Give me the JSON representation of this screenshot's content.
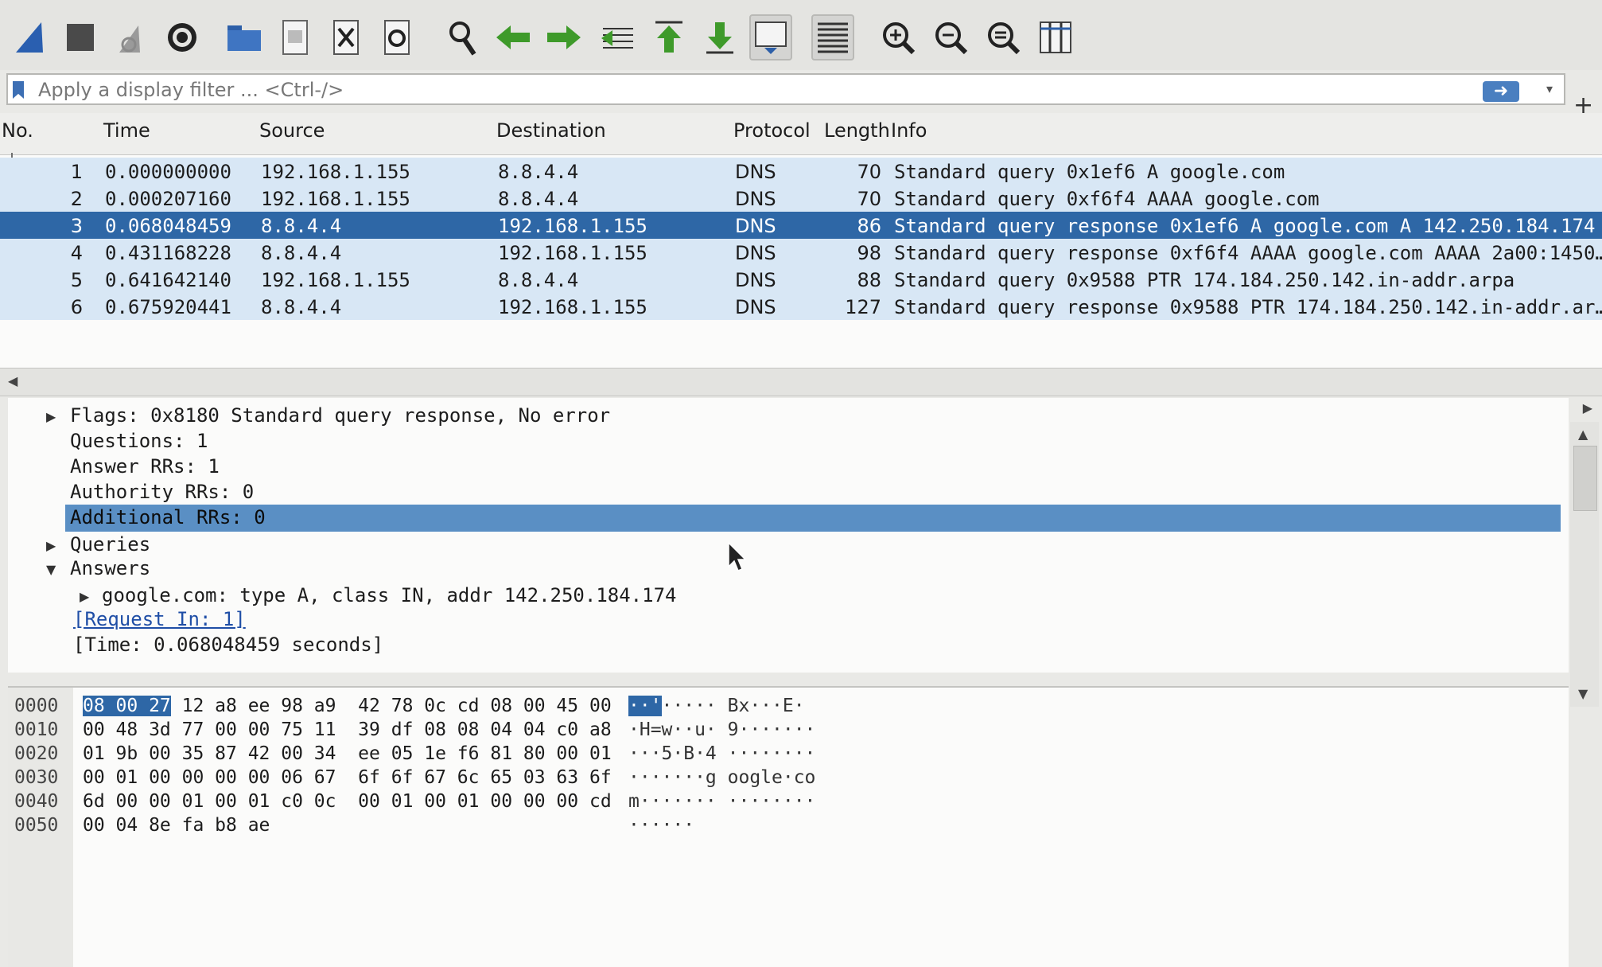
{
  "toolbar": {
    "icons": [
      "shark-fin-icon",
      "stop-icon",
      "restart-icon",
      "options-gear-icon",
      "open-folder-icon",
      "save-file-icon",
      "close-file-icon",
      "reload-icon",
      "find-icon",
      "back-arrow-icon",
      "forward-arrow-icon",
      "goto-packet-icon",
      "first-packet-icon",
      "last-packet-icon",
      "autoscroll-icon",
      "colorize-icon",
      "zoom-in-icon",
      "zoom-out-icon",
      "zoom-normal-icon",
      "resize-columns-icon"
    ]
  },
  "filter": {
    "placeholder": "Apply a display filter ... <Ctrl-/>",
    "value": ""
  },
  "packet_list": {
    "columns": [
      "No.",
      "Time",
      "Source",
      "Destination",
      "Protocol",
      "Length",
      "Info"
    ],
    "rows": [
      {
        "no": "1",
        "time": "0.000000000",
        "src": "192.168.1.155",
        "dst": "8.8.4.4",
        "proto": "DNS",
        "len": "70",
        "info": "Standard query 0x1ef6 A google.com",
        "selected": false
      },
      {
        "no": "2",
        "time": "0.000207160",
        "src": "192.168.1.155",
        "dst": "8.8.4.4",
        "proto": "DNS",
        "len": "70",
        "info": "Standard query 0xf6f4 AAAA google.com",
        "selected": false
      },
      {
        "no": "3",
        "time": "0.068048459",
        "src": "8.8.4.4",
        "dst": "192.168.1.155",
        "proto": "DNS",
        "len": "86",
        "info": "Standard query response 0x1ef6 A google.com A 142.250.184.174",
        "selected": true
      },
      {
        "no": "4",
        "time": "0.431168228",
        "src": "8.8.4.4",
        "dst": "192.168.1.155",
        "proto": "DNS",
        "len": "98",
        "info": "Standard query response 0xf6f4 AAAA google.com AAAA 2a00:1450…",
        "selected": false
      },
      {
        "no": "5",
        "time": "0.641642140",
        "src": "192.168.1.155",
        "dst": "8.8.4.4",
        "proto": "DNS",
        "len": "88",
        "info": "Standard query 0x9588 PTR 174.184.250.142.in-addr.arpa",
        "selected": false
      },
      {
        "no": "6",
        "time": "0.675920441",
        "src": "8.8.4.4",
        "dst": "192.168.1.155",
        "proto": "DNS",
        "len": "127",
        "info": "Standard query response 0x9588 PTR 174.184.250.142.in-addr.ar…",
        "selected": false
      }
    ]
  },
  "details": {
    "flags": "Flags: 0x8180 Standard query response, No error",
    "questions": "Questions: 1",
    "answer_rrs": "Answer RRs: 1",
    "authority_rrs": "Authority RRs: 0",
    "additional_rrs": "Additional RRs: 0",
    "queries": "Queries",
    "answers": "Answers",
    "answer_entry": "google.com: type A, class IN, addr 142.250.184.174",
    "request_in": "[Request In: 1]",
    "time": "[Time: 0.068048459 seconds]"
  },
  "bytes": {
    "rows": [
      {
        "offset": "0000",
        "hl": "08 00 27",
        "hex": " 12 a8 ee 98 a9  42 78 0c cd 08 00 45 00",
        "ascii_hl": "··'",
        "ascii": "····· Bx···E·"
      },
      {
        "offset": "0010",
        "hl": "",
        "hex": "00 48 3d 77 00 00 75 11  39 df 08 08 04 04 c0 a8",
        "ascii_hl": "",
        "ascii": "·H=w··u· 9·······"
      },
      {
        "offset": "0020",
        "hl": "",
        "hex": "01 9b 00 35 87 42 00 34  ee 05 1e f6 81 80 00 01",
        "ascii_hl": "",
        "ascii": "···5·B·4 ········"
      },
      {
        "offset": "0030",
        "hl": "",
        "hex": "00 01 00 00 00 00 06 67  6f 6f 67 6c 65 03 63 6f",
        "ascii_hl": "",
        "ascii": "·······g oogle·co"
      },
      {
        "offset": "0040",
        "hl": "",
        "hex": "6d 00 00 01 00 01 c0 0c  00 01 00 01 00 00 00 cd",
        "ascii_hl": "",
        "ascii": "m······· ········"
      },
      {
        "offset": "0050",
        "hl": "",
        "hex": "00 04 8e fa b8 ae",
        "ascii_hl": "",
        "ascii": "······"
      }
    ]
  },
  "colors": {
    "selected_row": "#2e67a6",
    "row_bg": "#d8e7f5",
    "detail_selected": "#5a8fc4"
  }
}
